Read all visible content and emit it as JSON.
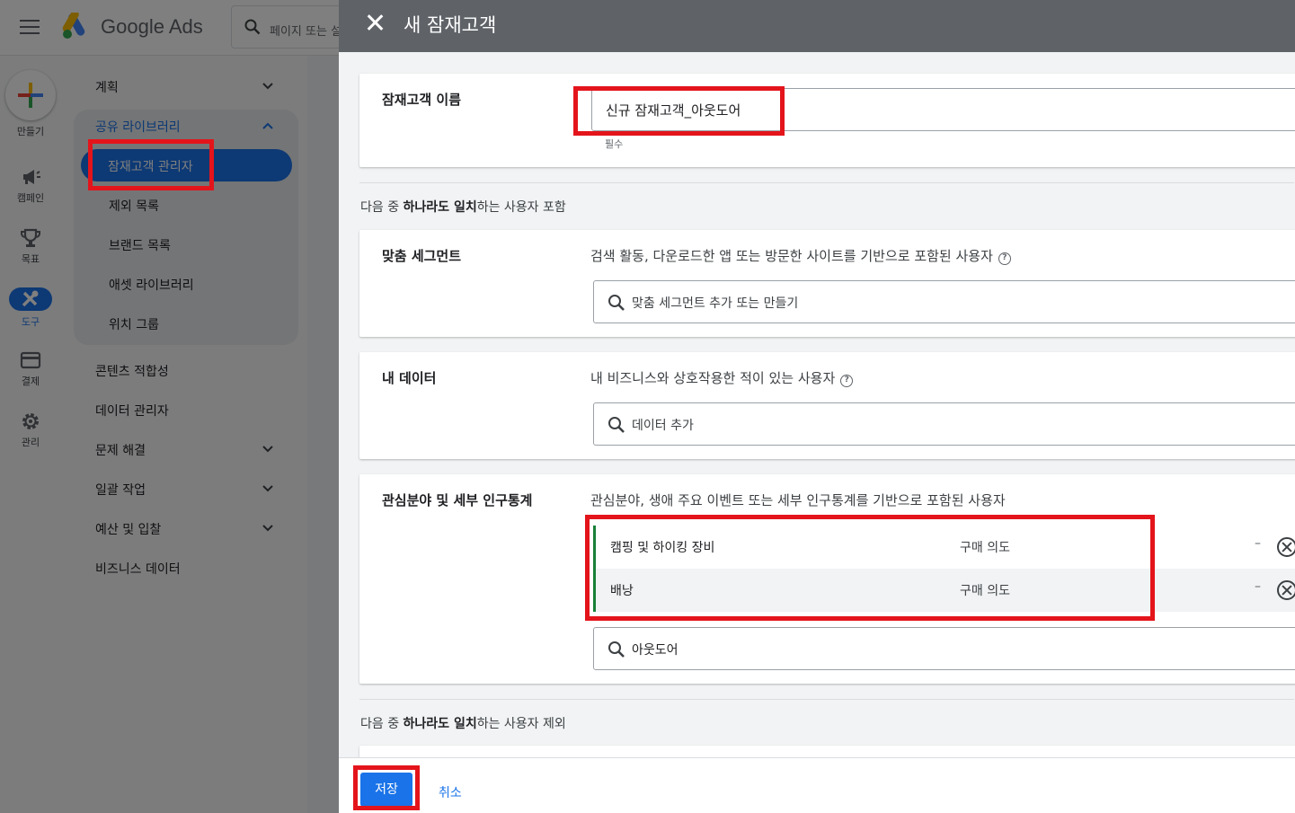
{
  "app": {
    "brand": "Google Ads",
    "search_placeholder": "페이지 또는 설"
  },
  "rail": [
    {
      "label": "만들기",
      "icon": "plus-icon"
    },
    {
      "label": "캠페인",
      "icon": "megaphone-icon"
    },
    {
      "label": "목표",
      "icon": "trophy-icon"
    },
    {
      "label": "도구",
      "icon": "tools-icon"
    },
    {
      "label": "결제",
      "icon": "credit-card-icon"
    },
    {
      "label": "관리",
      "icon": "gear-icon"
    }
  ],
  "nav": {
    "plan": "계획",
    "shared_library": "공유 라이브러리",
    "library_items": [
      "잠재고객 관리자",
      "제외 목록",
      "브랜드 목록",
      "애셋 라이브러리",
      "위치 그룹"
    ],
    "content_suitability": "콘텐츠 적합성",
    "data_manager": "데이터 관리자",
    "troubleshooting": "문제 해결",
    "bulk_actions": "일괄 작업",
    "budget_bidding": "예산 및 입찰",
    "business_data": "비즈니스 데이터"
  },
  "panel": {
    "title": "새 잠재고객",
    "name_label": "잠재고객 이름",
    "name_value": "신규 잠재고객_아웃도어",
    "required": "필수",
    "include_prefix": "다음 중 ",
    "include_bold": "하나라도 일치",
    "include_suffix": "하는 사용자 포함",
    "custom_segments": {
      "label": "맞춤 세그먼트",
      "desc": "검색 활동, 다운로드한 앱 또는 방문한 사이트를 기반으로 포함된 사용자",
      "placeholder": "맞춤 세그먼트 추가 또는 만들기"
    },
    "your_data": {
      "label": "내 데이터",
      "desc": "내 비즈니스와 상호작용한 적이 있는 사용자",
      "placeholder": "데이터 추가"
    },
    "interests": {
      "label": "관심분야 및 세부 인구통계",
      "desc": "관심분야, 생애 주요 이벤트 또는 세부 인구통계를 기반으로 포함된 사용자",
      "segments": [
        {
          "name": "캠핑 및 하이킹 장비",
          "type": "구매 의도",
          "dash": "–"
        },
        {
          "name": "배낭",
          "type": "구매 의도",
          "dash": "–"
        }
      ],
      "search_value": "아웃도어"
    },
    "exclude_prefix": "다음 중 ",
    "exclude_bold": "하나라도 일치",
    "exclude_suffix": "하는 사용자 제외",
    "save": "저장",
    "cancel": "취소"
  },
  "colors": {
    "accent": "#1a73e8",
    "highlight": "#e4141b",
    "segment_bar": "#188038"
  }
}
